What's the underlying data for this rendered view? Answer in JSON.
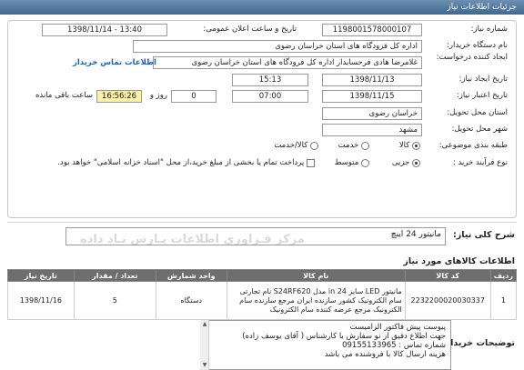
{
  "header": {
    "title": "جزئیات اطلاعات نیاز"
  },
  "fields": {
    "need_number_label": "شماره نیاز:",
    "need_number": "1198001578000107",
    "announce_label": "تاریخ و ساعت اعلان عمومی:",
    "announce_value": "1398/11/14 - 13:40",
    "buyer_label": "نام دستگاه خریدار:",
    "buyer_value": "اداره کل فرودگاه های استان خراسان رضوی",
    "requester_label": "ایجاد کننده درخواست:",
    "requester_value": "غلامرضا هادی فرحسابدار اداره کل فرودگاه های استان خراسان رضوی",
    "contact_link": "اطلاعات تماس خریدار",
    "created_label": "تاریخ ایجاد نیاز:",
    "created_date": "1398/11/13",
    "created_time": "15:13",
    "validity_label": "تاریخ اعتبار نیاز:",
    "validity_date": "1398/11/15",
    "validity_time": "07:00",
    "days_value": "0",
    "days_label": "روز و",
    "remaining_time": "16:56:26",
    "remaining_label": "ساعت باقی مانده",
    "province_label": "استان محل تحویل:",
    "province_value": "خراسان رضوی",
    "city_label": "شهر محل تحویل:",
    "city_value": "مشهد",
    "category_label": "طبقه بندی موضوعی:",
    "category_options": [
      "کالا",
      "خدمت",
      "کالا/خدمت"
    ],
    "purchase_label": "نوع فرآیند خرید :",
    "purchase_options": [
      "جزیی",
      "متوسط"
    ],
    "treasury_text": "پرداخت تمام یا بخشی از مبلغ خرید،از محل \"اسناد خزانه اسلامی\" خواهد بود."
  },
  "summary": {
    "label": "شرح کلی نیاز:",
    "value": "مانیتور 24 اینچ",
    "watermark": "مرکز فـراوری اطلاعات پـارس نـاد داده"
  },
  "goods": {
    "section_title": "اطلاعات کالاهای مورد نیاز",
    "columns": [
      "ردیف",
      "کد کالا",
      "نام کالا",
      "واحد شمارش",
      "تعداد / مقدار",
      "تاریخ نیاز"
    ],
    "rows": [
      {
        "row": "1",
        "code": "2232200020030337",
        "name": "مانیتور LED سایز 24 in مدل S24RF620 نام تجارتی سام الکترونیک کشور سازنده ایران مرجع سازنده سام الکترونیک مرجع عرضه کننده سام الکترونیک",
        "unit": "دستگاه",
        "qty": "5",
        "date": "1398/11/16"
      }
    ]
  },
  "notes": {
    "label": "توضیحات خریدار:",
    "lines": [
      "پیوست پیش فاکتور الزامیست",
      "جهت اطلاع دقیق از نو سفارش با کارشناس ( آقای یوسف زاده)",
      "شماره تماس : 09155133965",
      "هزینه ارسال کالا با فروشنده می باشد"
    ]
  }
}
